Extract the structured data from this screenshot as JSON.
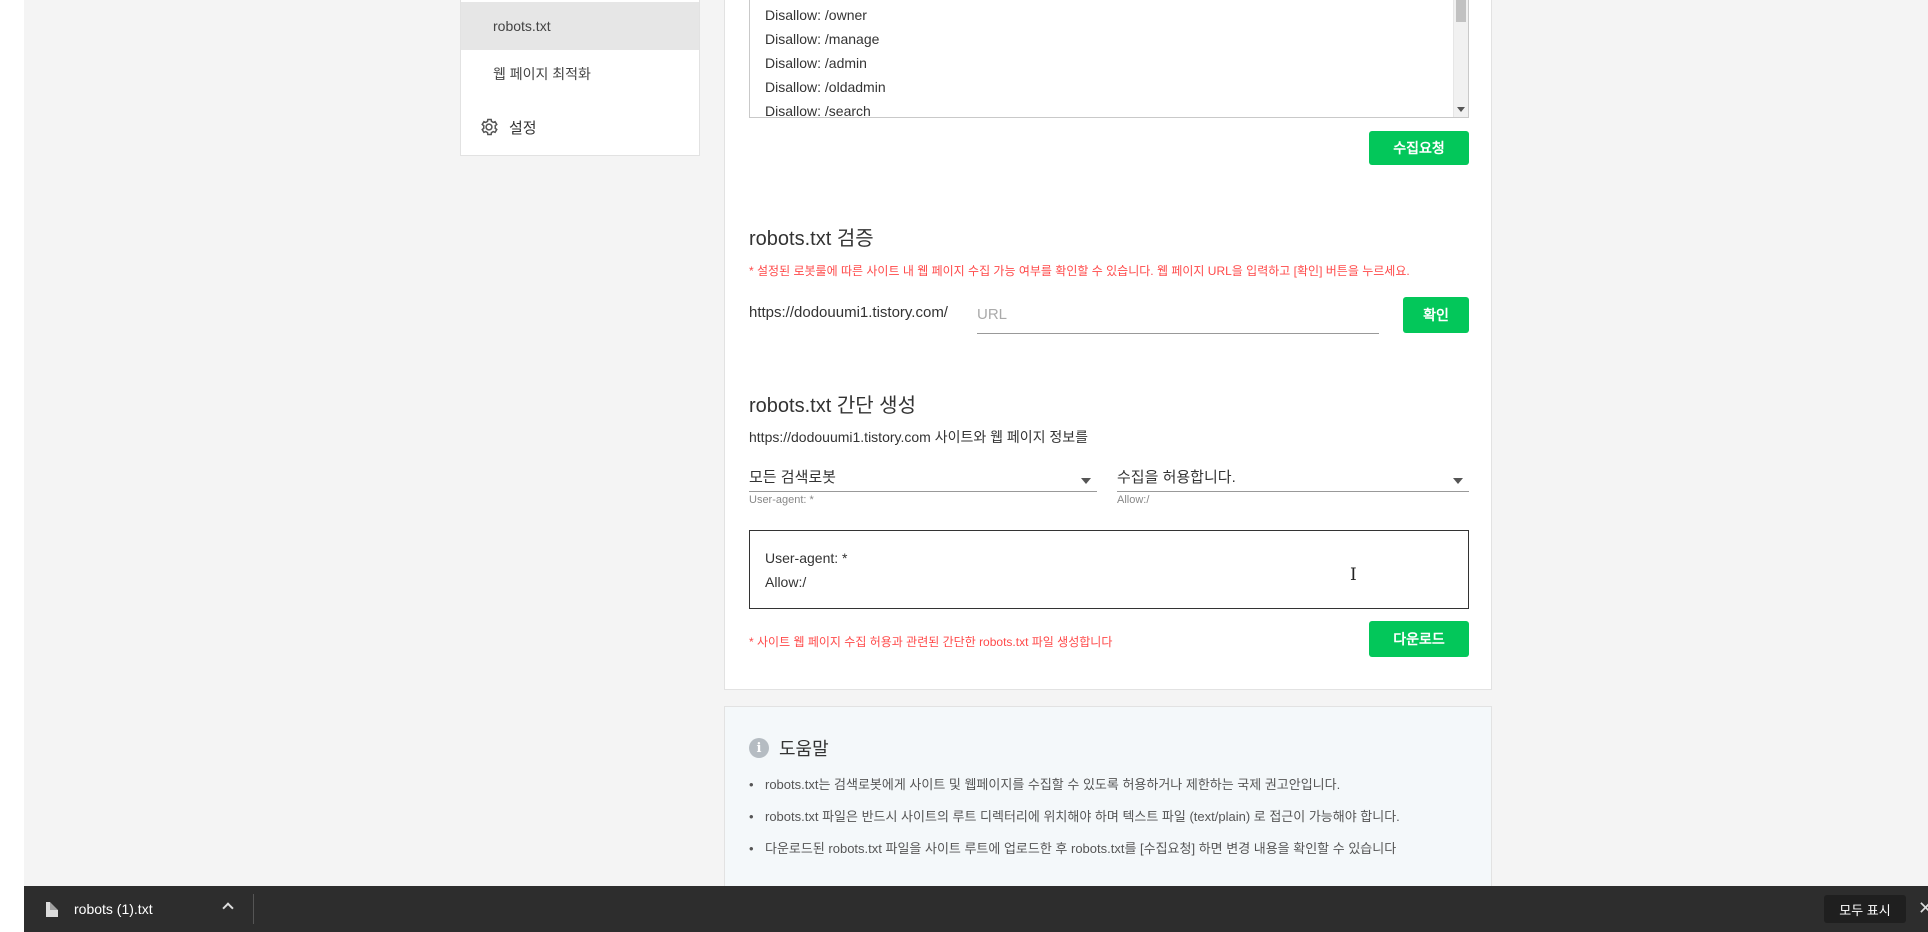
{
  "sidebar": {
    "items": [
      {
        "label": "robots.txt"
      },
      {
        "label": "웹 페이지 최적화"
      },
      {
        "label": "설정"
      }
    ]
  },
  "rules": {
    "lines": [
      "Disallow: /owner",
      "Disallow: /manage",
      "Disallow: /admin",
      "Disallow: /oldadmin",
      "Disallow: /search"
    ]
  },
  "collect_button": "수집요청",
  "verify": {
    "title": "robots.txt 검증",
    "note": "* 설정된 로봇룰에 따른 사이트 내 웹 페이지 수집 가능 여부를 확인할 수 있습니다. 웹 페이지 URL을 입력하고 [확인] 버튼을 누르세요.",
    "base_url": "https://dodouumi1.tistory.com/",
    "placeholder": "URL",
    "confirm_button": "확인"
  },
  "generate": {
    "title": "robots.txt 간단 생성",
    "site_text": "https://dodouumi1.tistory.com 사이트와 웹 페이지 정보를",
    "robot_select": {
      "value": "모든 검색로봇",
      "sub": "User-agent: *"
    },
    "allow_select": {
      "value": "수집을 허용합니다.",
      "sub": "Allow:/"
    },
    "output_lines": [
      "User-agent: *",
      "Allow:/"
    ],
    "note": "* 사이트 웹 페이지 수집 허용과 관련된 간단한 robots.txt 파일 생성합니다",
    "download_button": "다운로드"
  },
  "help": {
    "title": "도움말",
    "items": [
      "robots.txt는 검색로봇에게 사이트 및 웹페이지를 수집할 수 있도록 허용하거나 제한하는 국제 권고안입니다.",
      "robots.txt 파일은 반드시 사이트의 루트 디렉터리에 위치해야 하며 텍스트 파일 (text/plain) 로 접근이 가능해야 합니다.",
      "다운로드된 robots.txt 파일을 사이트 루트에 업로드한 후 robots.txt를 [수집요청] 하면 변경 내용을 확인할 수 있습니다"
    ]
  },
  "download_bar": {
    "file_name": "robots (1).txt",
    "show_all": "모두 표시"
  },
  "colors": {
    "accent": "#03c75a",
    "note_red": "#ff4a4a",
    "bar_bg": "#2d2d2d"
  }
}
